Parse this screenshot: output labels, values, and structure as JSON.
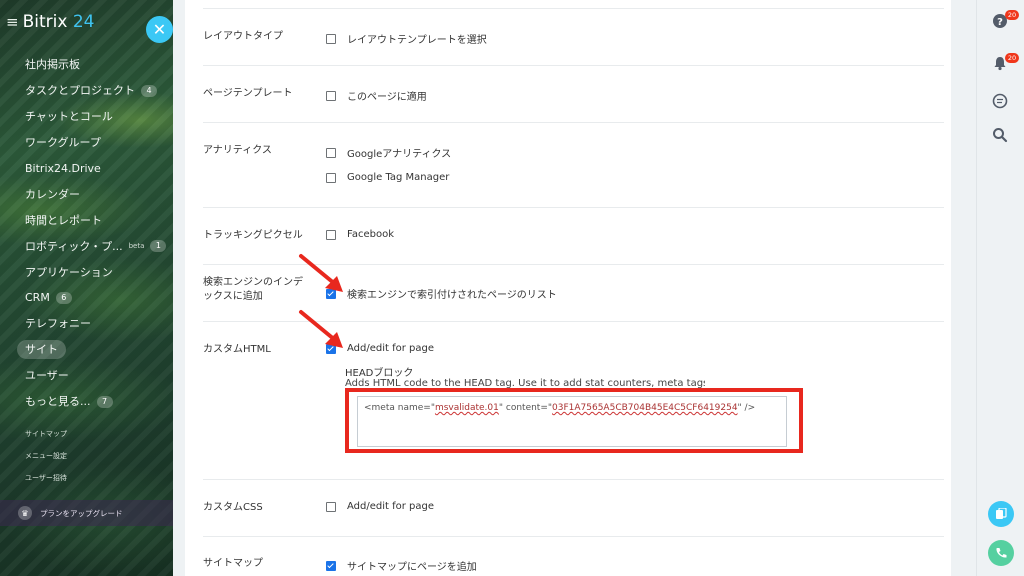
{
  "sidebar": {
    "logo_main": "Bitrix ",
    "logo_num": "24",
    "items": [
      {
        "label": "社内掲示板"
      },
      {
        "label": "タスクとプロジェクト",
        "count": "4"
      },
      {
        "label": "チャットとコール"
      },
      {
        "label": "ワークグループ"
      },
      {
        "label": "Bitrix24.Drive"
      },
      {
        "label": "カレンダー"
      },
      {
        "label": "時間とレポート"
      },
      {
        "label": "ロボティック・プ...",
        "beta": "beta",
        "count": "1"
      },
      {
        "label": "アプリケーション"
      },
      {
        "label": "CRM",
        "count": "6"
      },
      {
        "label": "テレフォニー"
      },
      {
        "label": "サイト",
        "active": true
      },
      {
        "label": "ユーザー"
      },
      {
        "label": "もっと見る...",
        "count": "7"
      }
    ],
    "small_links": [
      "サイトマップ",
      "メニュー設定",
      "ユーザー招待"
    ],
    "upgrade_label": "プランをアップグレード"
  },
  "settings": {
    "layout_type": {
      "label": "レイアウトタイプ",
      "option": "レイアウトテンプレートを選択",
      "checked": false
    },
    "page_template": {
      "label": "ページテンプレート",
      "option": "このページに適用",
      "checked": false
    },
    "analytics": {
      "label": "アナリティクス",
      "options": [
        "Googleアナリティクス",
        "Google Tag Manager"
      ]
    },
    "tracking": {
      "label": "トラッキングピクセル",
      "option": "Facebook"
    },
    "search_index": {
      "label": "検索エンジンのインデックスに追加",
      "option": "検索エンジンで索引付けされたページのリスト",
      "checked": true
    },
    "custom_html": {
      "label": "カスタムHTML",
      "option": "Add/edit for page",
      "checked": true,
      "head_title": "HEADブロック",
      "head_desc": "Adds HTML code to the HEAD tag. Use it to add stat counters, meta tags etc.",
      "code_pre": "<meta name=\"",
      "code_name": "msvalidate.01",
      "code_mid": "\" content=\"",
      "code_value": "03F1A7565A5CB704B45E4C5CF6419254",
      "code_post": "\" />"
    },
    "custom_css": {
      "label": "カスタムCSS",
      "option": "Add/edit for page",
      "checked": false
    },
    "sitemap": {
      "label": "サイトマップ",
      "option": "サイトマップにページを追加",
      "checked": true
    }
  },
  "rightbar": {
    "help_badge": "20",
    "notif_badge": "20"
  },
  "colors": {
    "accent": "#3bc8f5",
    "checkbox": "#1a73e8",
    "highlight": "#e8281e",
    "phone": "#55d0a0"
  }
}
